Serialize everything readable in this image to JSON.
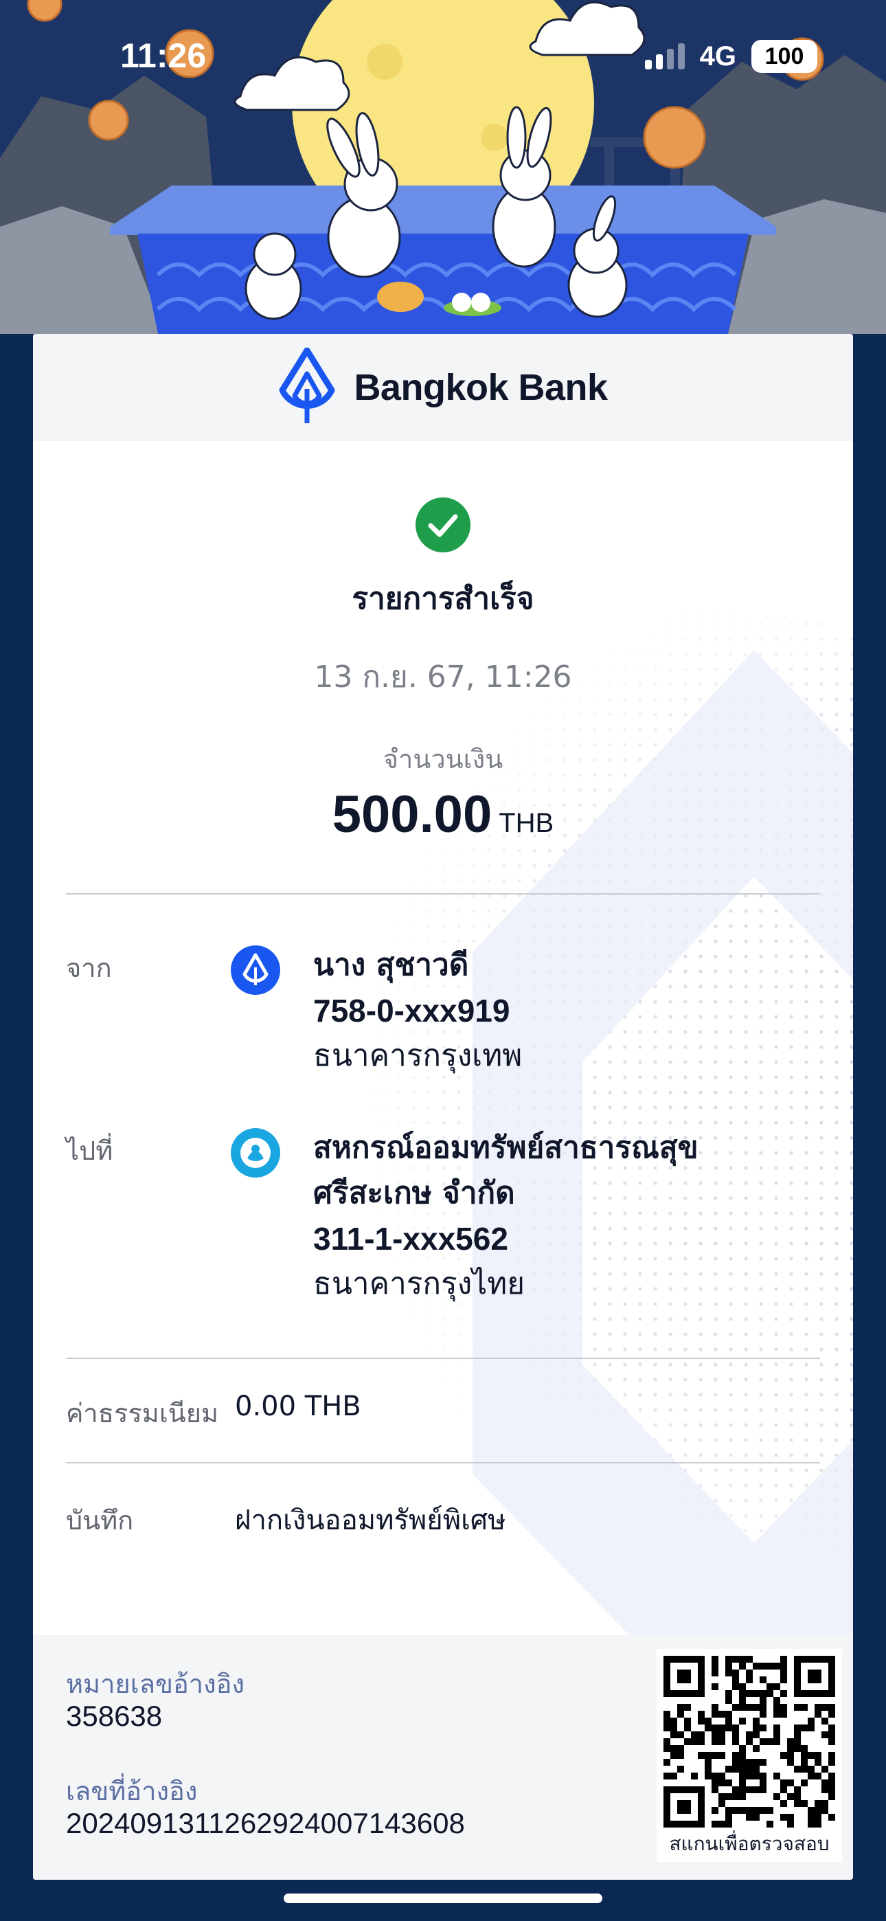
{
  "status_bar": {
    "time": "11:26",
    "network": "4G",
    "battery": "100"
  },
  "brand": {
    "name": "Bangkok Bank",
    "color": "#1a56f0"
  },
  "receipt": {
    "status": "รายการสำเร็จ",
    "datetime": "13 ก.ย. 67, 11:26",
    "amount_label": "จำนวนเงิน",
    "amount": "500.00",
    "currency": "THB",
    "from": {
      "label": "จาก",
      "name": "นาง สุชาวดี",
      "account": "758-0-xxx919",
      "bank": "ธนาคารกรุงเทพ",
      "icon": "bangkok-bank-logo-icon"
    },
    "to": {
      "label": "ไปที่",
      "name_line1": "สหกรณ์ออมทรัพย์สาธารณสุข",
      "name_line2": "ศรีสะเกษ จำกัด",
      "account": "311-1-xxx562",
      "bank": "ธนาคารกรุงไทย",
      "icon": "krungthai-bank-logo-icon"
    },
    "fee": {
      "label": "ค่าธรรมเนียม",
      "value": "0.00 THB"
    },
    "note": {
      "label": "บันทึก",
      "value": "ฝากเงินออมทรัพย์พิเศษ"
    },
    "reference_number": {
      "label": "หมายเลขอ้างอิง",
      "value": "358638"
    },
    "reference_id": {
      "label": "เลขที่อ้างอิง",
      "value": "2024091311262924007143608"
    },
    "qr": {
      "caption": "สแกนเพื่อตรวจสอบ"
    }
  },
  "colors": {
    "success": "#1e9e4a",
    "page_background": "#0b2754",
    "reference_label": "#5c6fa3"
  }
}
